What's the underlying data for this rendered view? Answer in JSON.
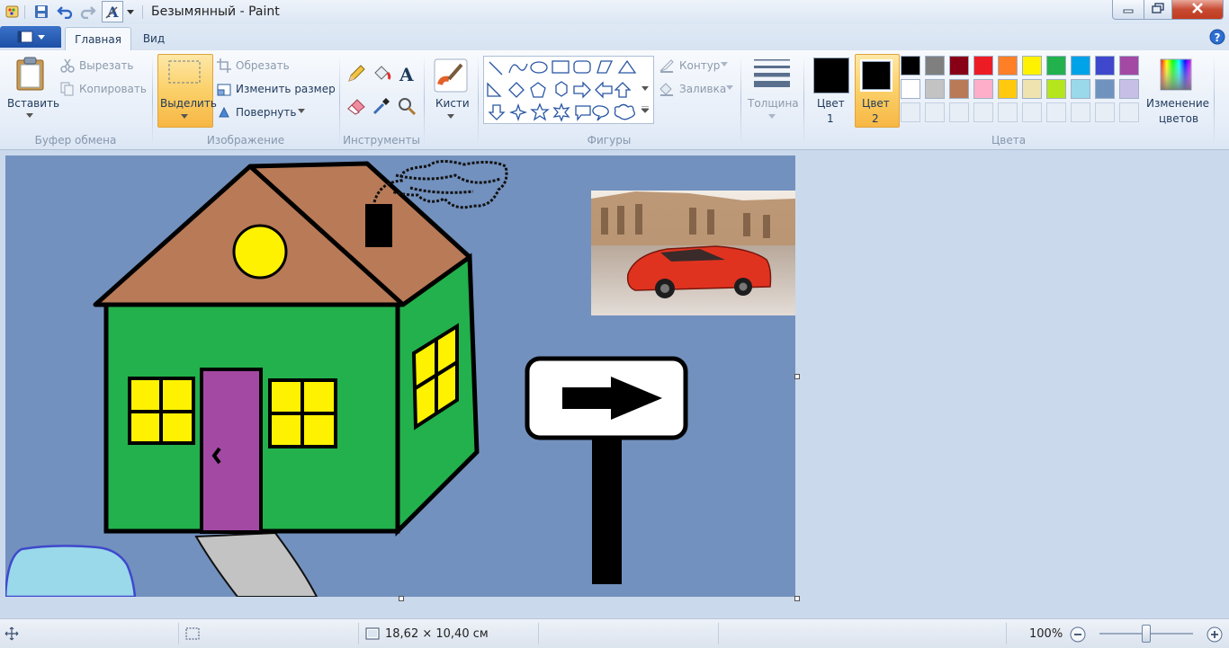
{
  "window": {
    "title": "Безымянный - Paint",
    "minimize_icon": "minimize-icon",
    "maximize_icon": "restore-icon",
    "close_icon": "close-icon"
  },
  "quick_access": [
    "paint-app-icon",
    "save-icon",
    "undo-icon",
    "redo-icon",
    "text-format-icon",
    "customize-arrow-icon"
  ],
  "tabs": [
    {
      "label": "Главная",
      "active": true
    },
    {
      "label": "Вид",
      "active": false
    }
  ],
  "ribbon": {
    "clipboard": {
      "group_label": "Буфер обмена",
      "paste": "Вставить",
      "cut": "Вырезать",
      "copy": "Копировать"
    },
    "image": {
      "group_label": "Изображение",
      "select": "Выделить",
      "crop": "Обрезать",
      "resize": "Изменить размер",
      "rotate": "Повернуть"
    },
    "tools": {
      "group_label": "Инструменты",
      "items": [
        "pencil-icon",
        "fill-bucket-icon",
        "text-icon",
        "eraser-icon",
        "color-picker-icon",
        "magnifier-icon"
      ]
    },
    "brushes": {
      "label": "Кисти"
    },
    "shapes": {
      "group_label": "Фигуры",
      "outline": "Контур",
      "fill": "Заливка"
    },
    "size": {
      "label": "Толщина"
    },
    "colors": {
      "group_label": "Цвета",
      "color1_line1": "Цвет",
      "color1_line2": "1",
      "color2_line1": "Цвет",
      "color2_line2": "2",
      "edit_line1": "Изменение",
      "edit_line2": "цветов",
      "color1": "#000000",
      "color2": "#000000",
      "palette_row1": [
        "#000000",
        "#7f7f7f",
        "#880015",
        "#ed1c24",
        "#ff7f27",
        "#fff200",
        "#22b14c",
        "#00a2e8",
        "#3f48cc",
        "#a349a4"
      ],
      "palette_row2": [
        "#ffffff",
        "#c3c3c3",
        "#b97a57",
        "#ffaec9",
        "#ffc90e",
        "#efe4b0",
        "#b5e61d",
        "#99d9ea",
        "#7092be",
        "#c8bfe7"
      ]
    }
  },
  "status": {
    "dimensions": "18,62 × 10,40 см",
    "zoom": "100%",
    "zoom_slider_level": 0.5
  },
  "canvas": {
    "background": "#7291be",
    "house_wall": "#22b14c",
    "roof": "#b97a57",
    "window_color": "#fff200",
    "door": "#a349a4",
    "path": "#c3c3c3",
    "pond": "#99d9ea",
    "photo_subject": "red sports car"
  }
}
